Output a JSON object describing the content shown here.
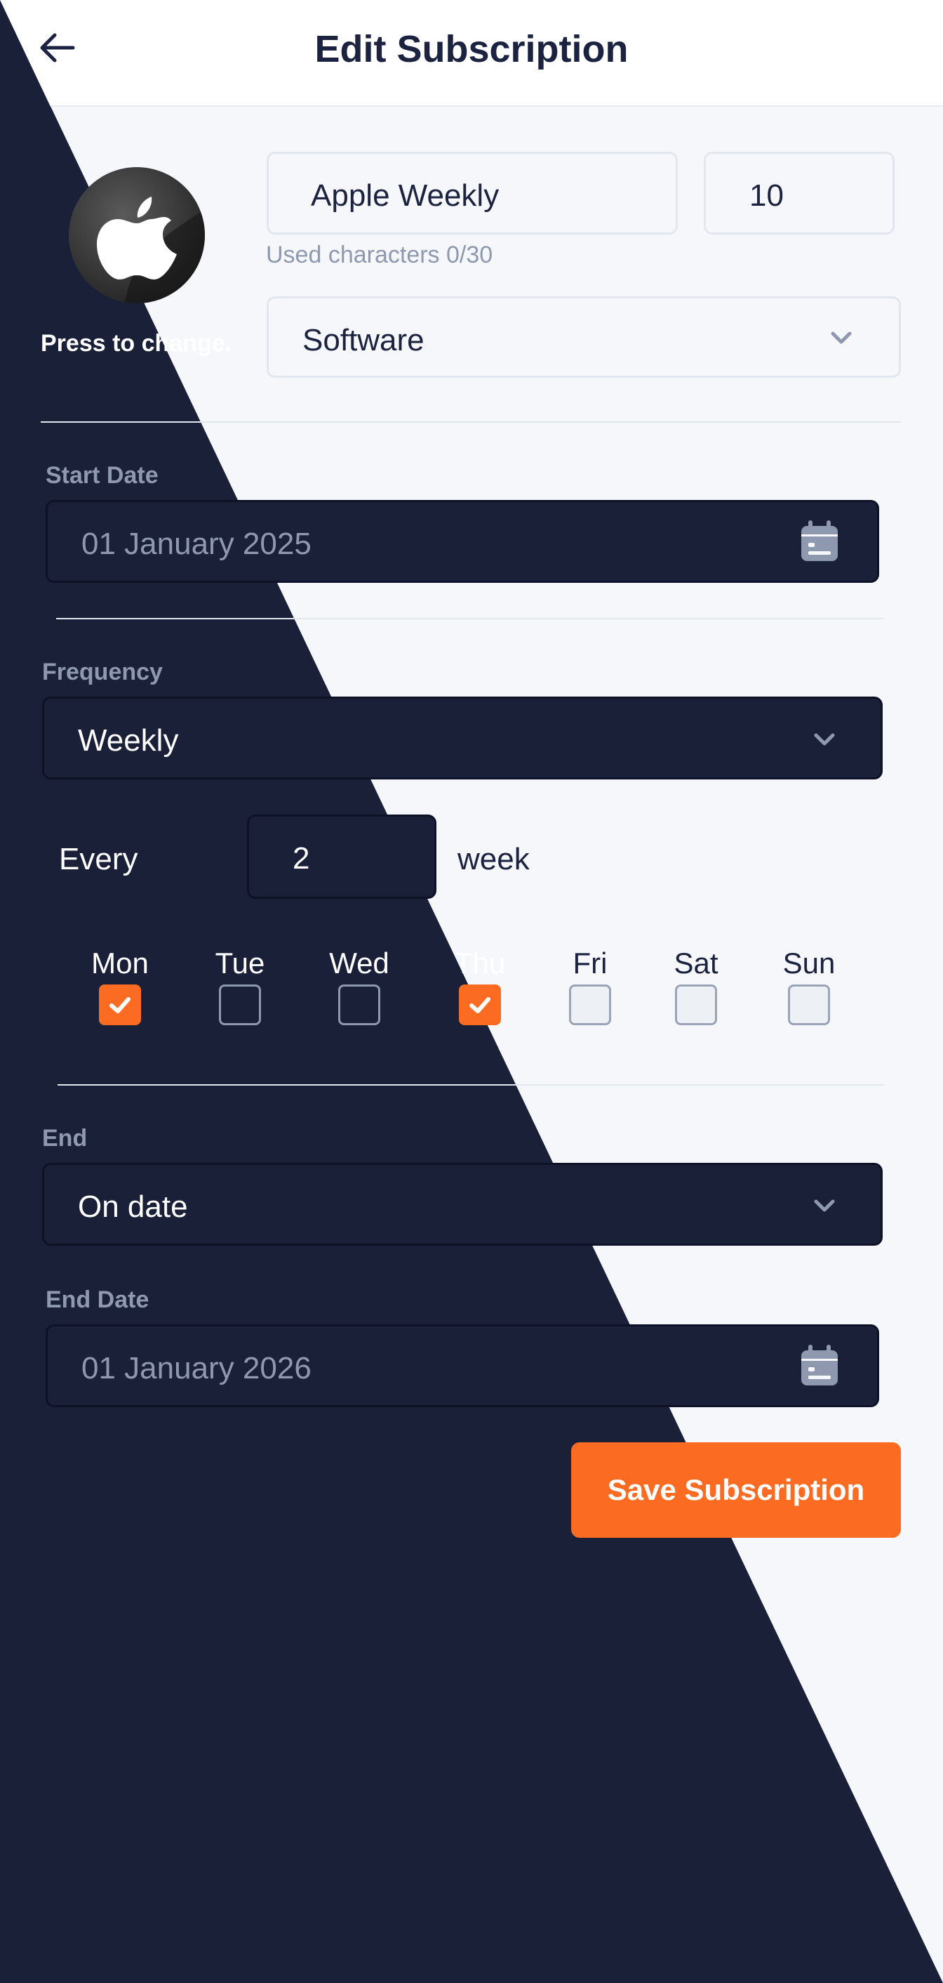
{
  "header": {
    "title": "Edit Subscription",
    "back_icon": "arrow-left-icon"
  },
  "logo": {
    "icon": "apple-logo-icon",
    "change_hint": "Press to change."
  },
  "name_field": {
    "value": "Apple Weekly",
    "char_counter": "Used characters 0/30"
  },
  "price_field": {
    "value": "10"
  },
  "category_select": {
    "value": "Software",
    "icon": "chevron-down-icon"
  },
  "start_date": {
    "label": "Start Date",
    "value": "01 January 2025",
    "icon": "calendar-icon"
  },
  "frequency": {
    "label": "Frequency",
    "value": "Weekly",
    "icon": "chevron-down-icon"
  },
  "interval": {
    "prefix": "Every",
    "value": "2",
    "unit": "week"
  },
  "days": [
    {
      "label": "Mon",
      "checked": true
    },
    {
      "label": "Tue",
      "checked": false
    },
    {
      "label": "Wed",
      "checked": false
    },
    {
      "label": "Thu",
      "checked": true
    },
    {
      "label": "Fri",
      "checked": false
    },
    {
      "label": "Sat",
      "checked": false
    },
    {
      "label": "Sun",
      "checked": false
    }
  ],
  "end": {
    "label": "End",
    "value": "On date",
    "icon": "chevron-down-icon"
  },
  "end_date": {
    "label": "End Date",
    "value": "01 January 2026",
    "icon": "calendar-icon"
  },
  "actions": {
    "save_label": "Save Subscription"
  },
  "colors": {
    "accent": "#fb6c22",
    "navy": "#1b2039",
    "text": "#1c2340",
    "muted": "#8e98ae"
  }
}
